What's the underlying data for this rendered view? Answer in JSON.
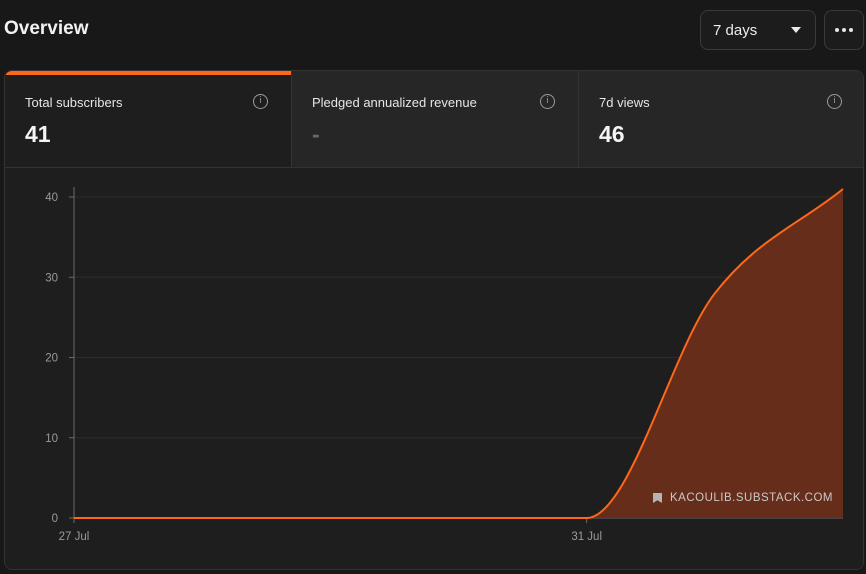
{
  "header": {
    "title": "Overview",
    "range_select": "7 days"
  },
  "stats": [
    {
      "label": "Total subscribers",
      "value": "41"
    },
    {
      "label": "Pledged annualized revenue",
      "value": "-"
    },
    {
      "label": "7d views",
      "value": "46"
    }
  ],
  "watermark": "KACOULIB.SUBSTACK.COM",
  "colors": {
    "accent": "#ff6719",
    "area_fill": "#6a2f1a"
  },
  "icons": {
    "info": "info-icon",
    "more": "more-icon",
    "dropdown": "caret-down-icon",
    "watermark": "bookmark-icon"
  },
  "chart_data": {
    "type": "area",
    "x_tick_labels": [
      "27 Jul",
      "31 Jul"
    ],
    "y_ticks": [
      0,
      10,
      20,
      30,
      40
    ],
    "ylim": [
      0,
      41
    ],
    "grid": true,
    "series": [
      {
        "x": [
          "27 Jul",
          "28 Jul",
          "29 Jul",
          "30 Jul",
          "31 Jul",
          "1 Aug",
          "2 Aug"
        ],
        "values": [
          0,
          0,
          0,
          0,
          0,
          28,
          41
        ]
      }
    ]
  }
}
